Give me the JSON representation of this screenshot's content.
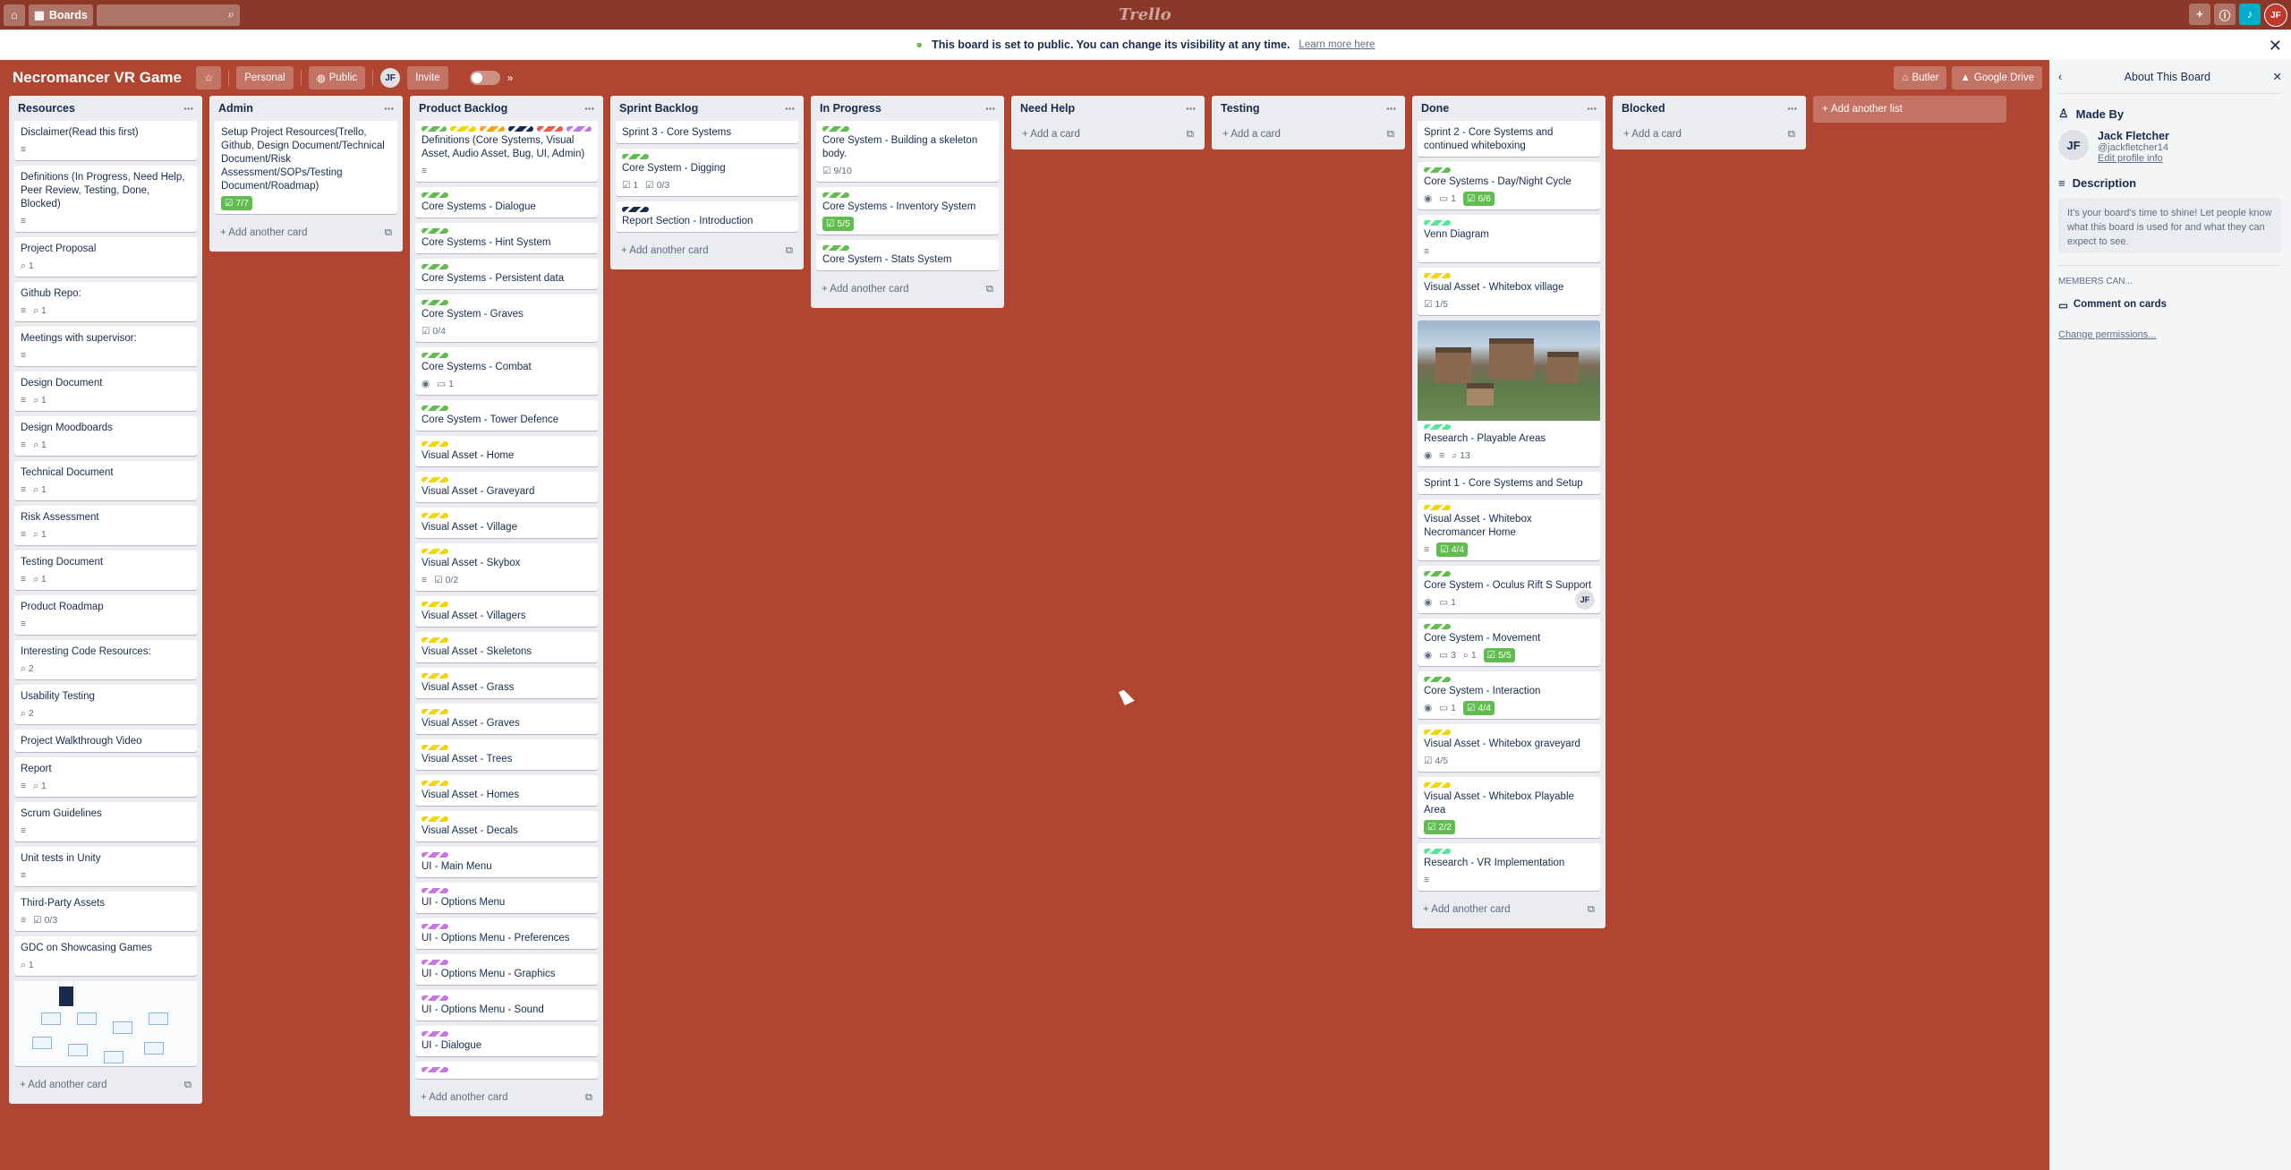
{
  "topbar": {
    "home_icon": "home-icon",
    "boards_label": "Boards",
    "search_icon": "search-icon",
    "logo": "Trello",
    "avatar": "JF"
  },
  "banner": {
    "text": "This board is set to public. You can change its visibility at any time.",
    "link": "Learn more here"
  },
  "header": {
    "title": "Necromancer VR Game",
    "team": "Personal",
    "visibility": "Public",
    "member": "JF",
    "invite": "Invite",
    "butler": "Butler",
    "drive": "Google Drive"
  },
  "lists": [
    {
      "title": "Resources",
      "add": "Add another card",
      "cards": [
        {
          "title": "Disclaimer(Read this first)",
          "badges": [
            "desc"
          ]
        },
        {
          "title": "Definitions (In Progress, Need Help, Peer Review, Testing, Done, Blocked)",
          "badges": [
            "desc"
          ]
        },
        {
          "title": "Project Proposal",
          "badges": [
            "attach:1"
          ]
        },
        {
          "title": "Github Repo:",
          "badges": [
            "desc",
            "attach:1"
          ]
        },
        {
          "title": "Meetings with supervisor:",
          "badges": [
            "desc"
          ]
        },
        {
          "title": "Design Document",
          "badges": [
            "desc",
            "attach:1"
          ]
        },
        {
          "title": "Design Moodboards",
          "badges": [
            "desc",
            "attach:1"
          ]
        },
        {
          "title": "Technical Document",
          "badges": [
            "desc",
            "attach:1"
          ]
        },
        {
          "title": "Risk Assessment",
          "badges": [
            "desc",
            "attach:1"
          ]
        },
        {
          "title": "Testing Document",
          "badges": [
            "desc",
            "attach:1"
          ]
        },
        {
          "title": "Product Roadmap",
          "badges": [
            "desc"
          ]
        },
        {
          "title": "Interesting Code Resources:",
          "badges": [
            "attach:2"
          ]
        },
        {
          "title": "Usability Testing",
          "badges": [
            "attach:2"
          ]
        },
        {
          "title": "Project Walkthrough Video",
          "badges": []
        },
        {
          "title": "Report",
          "badges": [
            "desc",
            "attach:1"
          ]
        },
        {
          "title": "Scrum Guidelines",
          "badges": [
            "desc"
          ]
        },
        {
          "title": "Unit tests in Unity",
          "badges": [
            "desc"
          ]
        },
        {
          "title": "Third-Party Assets",
          "badges": [
            "desc",
            "check:0/3"
          ]
        },
        {
          "title": "GDC on Showcasing Games",
          "badges": [
            "attach:1"
          ]
        },
        {
          "title": "",
          "diagram": true,
          "badges": []
        }
      ]
    },
    {
      "title": "Admin",
      "add": "Add another card",
      "cards": [
        {
          "title": "Setup Project Resources(Trello, Github, Design Document/Technical Document/Risk Assessment/SOPs/Testing Document/Roadmap)",
          "badges": [
            "done:7/7"
          ]
        }
      ]
    },
    {
      "title": "Product Backlog",
      "add": "Add another card",
      "cards": [
        {
          "title": "Definitions (Core Systems, Visual Asset, Audio Asset, Bug, UI, Admin)",
          "labels": [
            "#61bd4f",
            "#f2d600",
            "#ff9f1a",
            "#172b4d",
            "#eb5a46",
            "#c377e0"
          ],
          "badges": [
            "desc"
          ]
        },
        {
          "title": "Core Systems - Dialogue",
          "labels": [
            "#61bd4f"
          ],
          "badges": []
        },
        {
          "title": "Core Systems - Hint System",
          "labels": [
            "#61bd4f"
          ],
          "badges": []
        },
        {
          "title": "Core Systems - Persistent data",
          "labels": [
            "#61bd4f"
          ],
          "badges": []
        },
        {
          "title": "Core System - Graves",
          "labels": [
            "#61bd4f"
          ],
          "badges": [
            "check:0/4"
          ]
        },
        {
          "title": "Core Systems - Combat",
          "labels": [
            "#61bd4f"
          ],
          "badges": [
            "watch",
            "comment:1"
          ]
        },
        {
          "title": "Core System - Tower Defence",
          "labels": [
            "#61bd4f"
          ],
          "badges": []
        },
        {
          "title": "Visual Asset - Home",
          "labels": [
            "#f2d600"
          ],
          "badges": []
        },
        {
          "title": "Visual Asset - Graveyard",
          "labels": [
            "#f2d600"
          ],
          "badges": []
        },
        {
          "title": "Visual Asset - Village",
          "labels": [
            "#f2d600"
          ],
          "badges": []
        },
        {
          "title": "Visual Asset - Skybox",
          "labels": [
            "#f2d600"
          ],
          "badges": [
            "desc",
            "check:0/2"
          ]
        },
        {
          "title": "Visual Asset - Villagers",
          "labels": [
            "#f2d600"
          ],
          "badges": []
        },
        {
          "title": "Visual Asset - Skeletons",
          "labels": [
            "#f2d600"
          ],
          "badges": []
        },
        {
          "title": "Visual Asset - Grass",
          "labels": [
            "#f2d600"
          ],
          "badges": []
        },
        {
          "title": "Visual Asset - Graves",
          "labels": [
            "#f2d600"
          ],
          "badges": []
        },
        {
          "title": "Visual Asset - Trees",
          "labels": [
            "#f2d600"
          ],
          "badges": []
        },
        {
          "title": "Visual Asset - Homes",
          "labels": [
            "#f2d600"
          ],
          "badges": []
        },
        {
          "title": "Visual Asset - Decals",
          "labels": [
            "#f2d600"
          ],
          "badges": []
        },
        {
          "title": "UI - Main Menu",
          "labels": [
            "#c377e0"
          ],
          "badges": []
        },
        {
          "title": "UI - Options Menu",
          "labels": [
            "#c377e0"
          ],
          "badges": []
        },
        {
          "title": "UI - Options Menu - Preferences",
          "labels": [
            "#c377e0"
          ],
          "badges": []
        },
        {
          "title": "UI - Options Menu - Graphics",
          "labels": [
            "#c377e0"
          ],
          "badges": []
        },
        {
          "title": "UI - Options Menu - Sound",
          "labels": [
            "#c377e0"
          ],
          "badges": []
        },
        {
          "title": "UI - Dialogue",
          "labels": [
            "#c377e0"
          ],
          "badges": []
        },
        {
          "title": "",
          "labels": [
            "#c377e0"
          ],
          "badges": []
        }
      ]
    },
    {
      "title": "Sprint Backlog",
      "add": "Add another card",
      "cards": [
        {
          "title": "Sprint 3 - Core Systems",
          "badges": []
        },
        {
          "title": "Core System - Digging",
          "labels": [
            "#61bd4f"
          ],
          "badges": [
            "check:1",
            "check:0/3"
          ]
        },
        {
          "title": "Report Section - Introduction",
          "labels": [
            "#172b4d"
          ],
          "badges": []
        }
      ]
    },
    {
      "title": "In Progress",
      "add": "Add another card",
      "cards": [
        {
          "title": "Core System - Building a skeleton body.",
          "labels": [
            "#61bd4f"
          ],
          "badges": [
            "check:9/10"
          ]
        },
        {
          "title": "Core Systems - Inventory System",
          "labels": [
            "#61bd4f"
          ],
          "badges": [
            "done:5/5"
          ]
        },
        {
          "title": "Core System - Stats System",
          "labels": [
            "#61bd4f"
          ],
          "badges": []
        }
      ]
    },
    {
      "title": "Need Help",
      "add": "Add a card",
      "cards": []
    },
    {
      "title": "Testing",
      "add": "Add a card",
      "cards": []
    },
    {
      "title": "Done",
      "add": "Add another card",
      "cards": [
        {
          "title": "Sprint 2 - Core Systems and continued whiteboxing",
          "badges": []
        },
        {
          "title": "Core Systems - Day/Night Cycle",
          "labels": [
            "#61bd4f"
          ],
          "badges": [
            "watch",
            "comment:1",
            "done:6/6"
          ]
        },
        {
          "title": "Venn Diagram",
          "labels": [
            "#51e898"
          ],
          "badges": [
            "desc"
          ]
        },
        {
          "title": "Visual Asset - Whitebox village",
          "labels": [
            "#f2d600"
          ],
          "badges": [
            "check:1/5"
          ]
        },
        {
          "title": "Research - Playable Areas",
          "cover": true,
          "labels": [
            "#51e898"
          ],
          "badges": [
            "watch",
            "desc",
            "attach:13"
          ]
        },
        {
          "title": "Sprint 1 - Core Systems and Setup",
          "badges": []
        },
        {
          "title": "Visual Asset - Whitebox Necromancer Home",
          "labels": [
            "#f2d600"
          ],
          "badges": [
            "desc",
            "done:4/4"
          ]
        },
        {
          "title": "Core System - Oculus Rift S Support",
          "labels": [
            "#61bd4f"
          ],
          "badges": [
            "watch",
            "comment:1"
          ],
          "member": "JF"
        },
        {
          "title": "Core System - Movement",
          "labels": [
            "#61bd4f"
          ],
          "badges": [
            "watch",
            "comment:3",
            "attach:1",
            "done:5/5"
          ]
        },
        {
          "title": "Core System - Interaction",
          "labels": [
            "#61bd4f"
          ],
          "badges": [
            "watch",
            "comment:1",
            "done:4/4"
          ]
        },
        {
          "title": "Visual Asset - Whitebox graveyard",
          "labels": [
            "#f2d600"
          ],
          "badges": [
            "check:4/5"
          ]
        },
        {
          "title": "Visual Asset - Whitebox Playable Area",
          "labels": [
            "#f2d600"
          ],
          "badges": [
            "done:2/2"
          ]
        },
        {
          "title": "Research - VR Implementation",
          "labels": [
            "#51e898"
          ],
          "badges": [
            "desc"
          ]
        }
      ]
    },
    {
      "title": "Blocked",
      "add": "Add a card",
      "cards": []
    }
  ],
  "add_list": "Add another list",
  "sidebar": {
    "title": "About This Board",
    "made_by": "Made By",
    "user_initials": "JF",
    "user_name": "Jack Fletcher",
    "user_handle": "@jackfletcher14",
    "edit_profile": "Edit profile info",
    "description_title": "Description",
    "description": "It's your board's time to shine! Let people know what this board is used for and what they can expect to see.",
    "members_can": "MEMBERS CAN...",
    "permission": "Comment on cards",
    "change": "Change permissions..."
  }
}
